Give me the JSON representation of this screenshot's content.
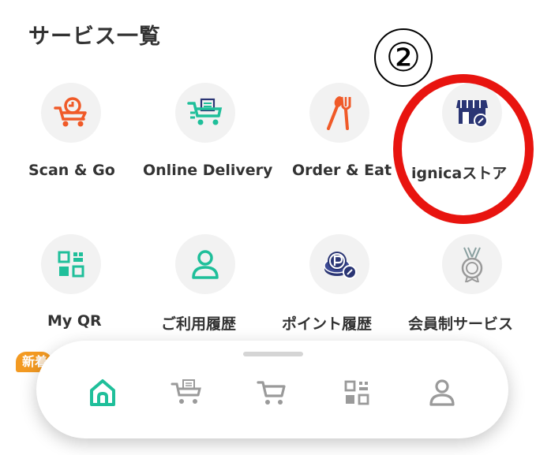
{
  "section_title": "サービス一覧",
  "annotation": {
    "number": "②",
    "ring_color": "#e8140f"
  },
  "services_row1": [
    {
      "label": "Scan & Go",
      "icon": "scan-and-go-cart-icon"
    },
    {
      "label": "Online Delivery",
      "icon": "online-delivery-cart-icon"
    },
    {
      "label": "Order & Eat",
      "icon": "spoon-fork-icon"
    },
    {
      "label": "ignicaストア",
      "icon": "storefront-icon"
    }
  ],
  "services_row2": [
    {
      "label": "My QR",
      "icon": "qr-code-icon"
    },
    {
      "label": "ご利用履歴",
      "icon": "person-icon"
    },
    {
      "label": "ポイント履歴",
      "icon": "point-coin-icon"
    },
    {
      "label": "会員制サービス",
      "icon": "medal-icon"
    }
  ],
  "badge": {
    "label": "新着"
  },
  "bottom_nav": [
    {
      "name": "home",
      "icon": "home-icon",
      "active": true
    },
    {
      "name": "online-delivery",
      "icon": "delivery-cart-icon",
      "active": false
    },
    {
      "name": "cart",
      "icon": "cart-icon",
      "active": false
    },
    {
      "name": "qr",
      "icon": "qr-code-icon",
      "active": false
    },
    {
      "name": "account",
      "icon": "person-icon",
      "active": false
    }
  ],
  "colors": {
    "accent_orange": "#f05a28",
    "accent_green": "#1fbf9a",
    "navy": "#2a3574",
    "nav_gray": "#9a9a9a",
    "badge_orange": "#f39a22"
  }
}
